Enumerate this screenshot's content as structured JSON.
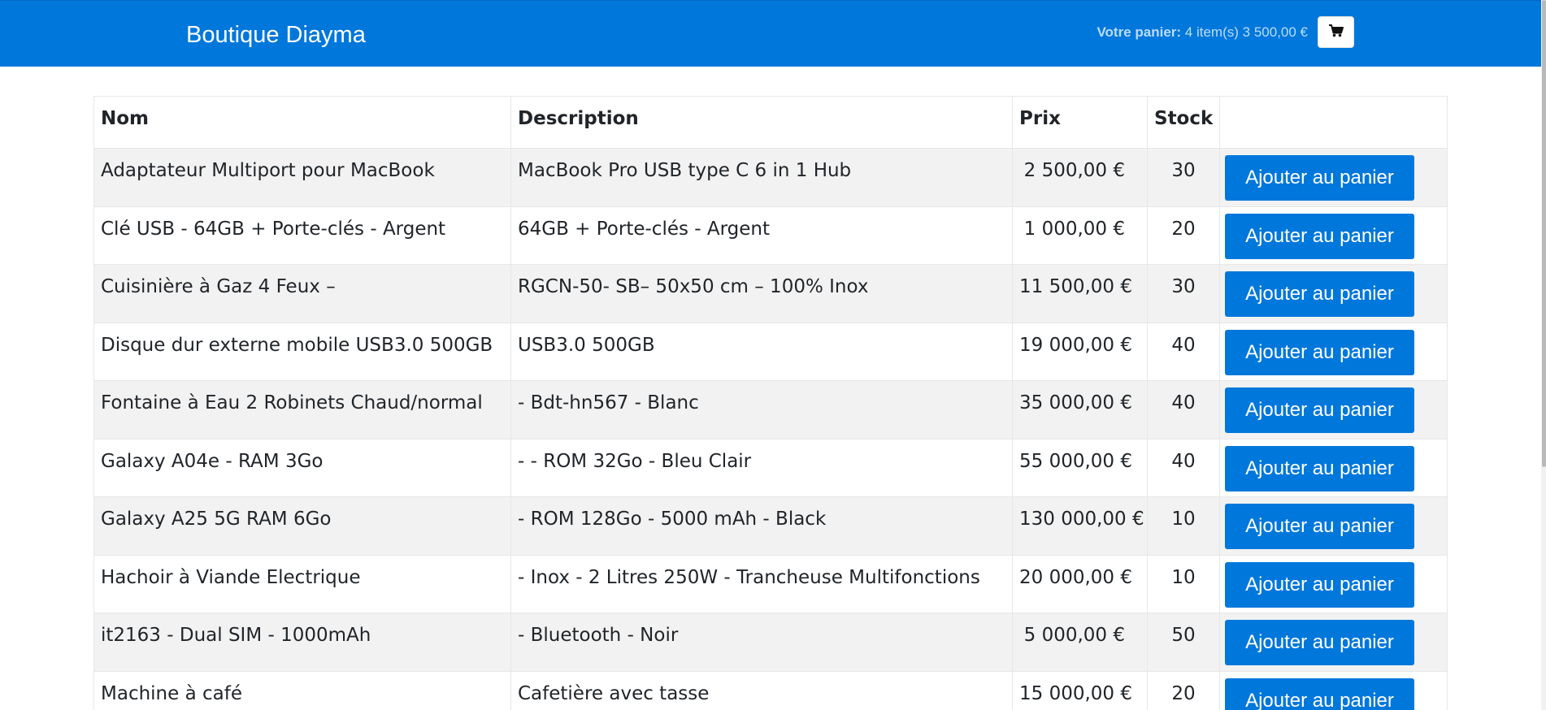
{
  "navbar": {
    "brand": "Boutique Diayma",
    "cart_label": "Votre panier:",
    "cart_summary": "4 item(s) 3 500,00 €",
    "cart_icon": "shopping-cart-icon"
  },
  "table": {
    "headers": {
      "name": "Nom",
      "description": "Description",
      "price": "Prix",
      "stock": "Stock",
      "action": ""
    },
    "rows": [
      {
        "name": "Adaptateur Multiport pour MacBook",
        "description": "MacBook Pro USB type C 6 in 1 Hub",
        "price": "2 500,00 €",
        "stock": "30",
        "button": "Ajouter au panier"
      },
      {
        "name": "Clé USB - 64GB + Porte-clés - Argent",
        "description": "64GB + Porte-clés - Argent",
        "price": "1 000,00 €",
        "stock": "20",
        "button": "Ajouter au panier"
      },
      {
        "name": "Cuisinière à Gaz 4 Feux –",
        "description": "RGCN-50- SB– 50x50 cm – 100% Inox",
        "price": "11 500,00 €",
        "stock": "30",
        "button": "Ajouter au panier"
      },
      {
        "name": "Disque dur externe mobile USB3.0 500GB",
        "description": "USB3.0 500GB",
        "price": "19 000,00 €",
        "stock": "40",
        "button": "Ajouter au panier"
      },
      {
        "name": "Fontaine à Eau 2 Robinets Chaud/normal",
        "description": "- Bdt-hn567 - Blanc",
        "price": "35 000,00 €",
        "stock": "40",
        "button": "Ajouter au panier"
      },
      {
        "name": "Galaxy A04e - RAM 3Go",
        "description": "- - ROM 32Go - Bleu Clair",
        "price": "55 000,00 €",
        "stock": "40",
        "button": "Ajouter au panier"
      },
      {
        "name": "Galaxy A25 5G RAM 6Go",
        "description": "- ROM 128Go - 5000 mAh - Black",
        "price": "130 000,00 €",
        "stock": "10",
        "button": "Ajouter au panier"
      },
      {
        "name": "Hachoir à Viande Electrique",
        "description": "- Inox - 2 Litres 250W - Trancheuse Multifonctions",
        "price": "20 000,00 €",
        "stock": "10",
        "button": "Ajouter au panier"
      },
      {
        "name": "it2163 - Dual SIM - 1000mAh",
        "description": "- Bluetooth - Noir",
        "price": "5 000,00 €",
        "stock": "50",
        "button": "Ajouter au panier"
      },
      {
        "name": "Machine à café",
        "description": "Cafetière avec tasse",
        "price": "15 000,00 €",
        "stock": "20",
        "button": "Ajouter au panier"
      }
    ]
  },
  "colors": {
    "primary": "#0077db",
    "row_stripe": "#f2f2f2"
  }
}
